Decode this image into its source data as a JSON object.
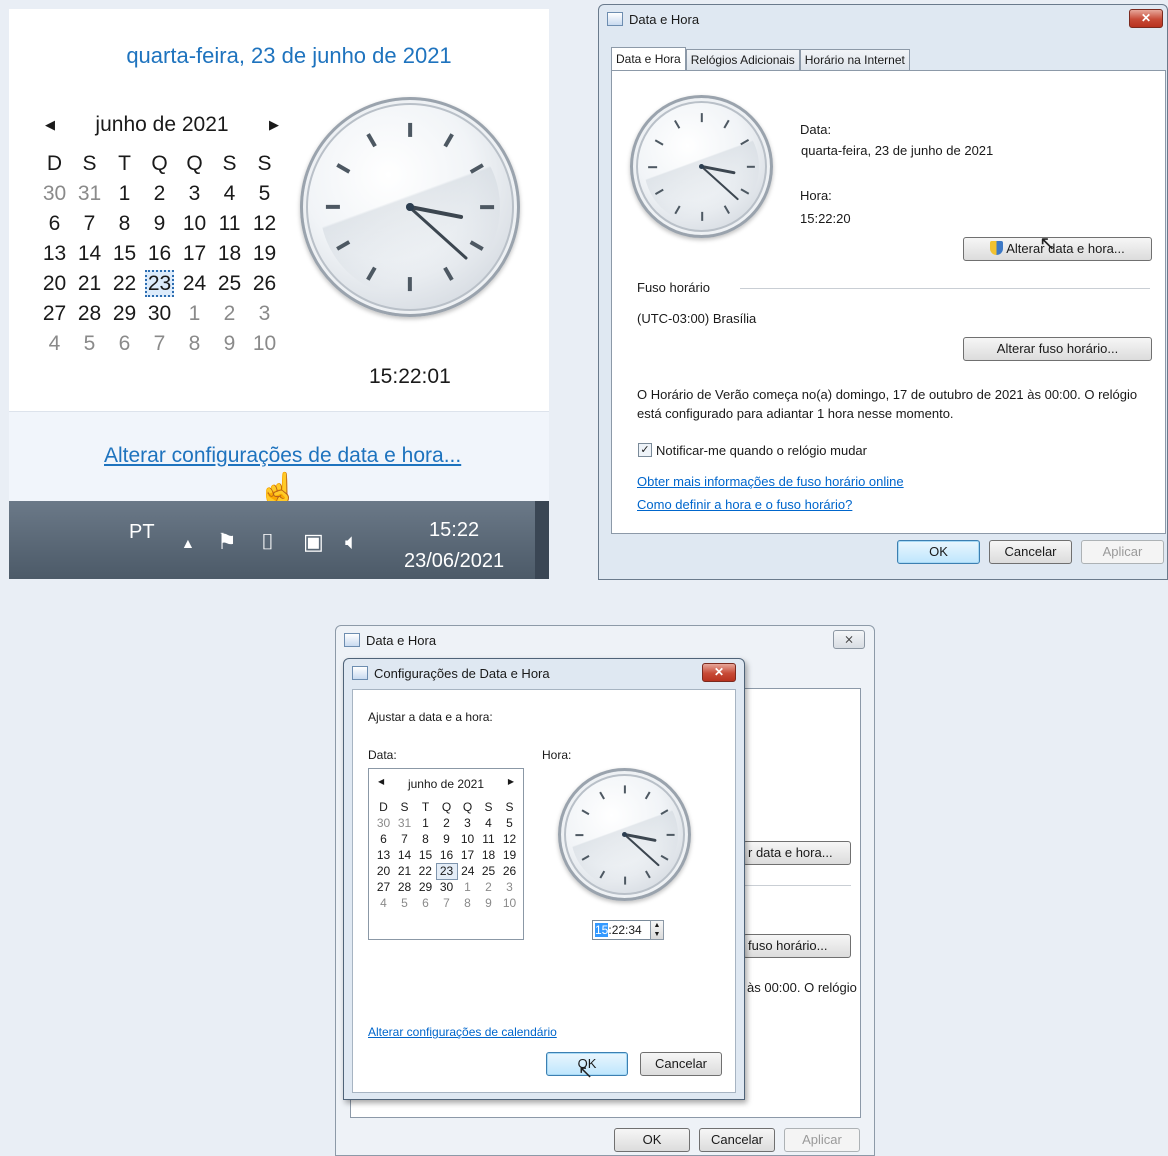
{
  "panel_a": {
    "date_title": "quarta-feira, 23 de junho de 2021",
    "month_label": "junho de 2021",
    "weekdays": [
      "D",
      "S",
      "T",
      "Q",
      "Q",
      "S",
      "S"
    ],
    "weeks": [
      [
        "30",
        "31",
        "1",
        "2",
        "3",
        "4",
        "5"
      ],
      [
        "6",
        "7",
        "8",
        "9",
        "10",
        "11",
        "12"
      ],
      [
        "13",
        "14",
        "15",
        "16",
        "17",
        "18",
        "19"
      ],
      [
        "20",
        "21",
        "22",
        "23",
        "24",
        "25",
        "26"
      ],
      [
        "27",
        "28",
        "29",
        "30",
        "1",
        "2",
        "3"
      ],
      [
        "4",
        "5",
        "6",
        "7",
        "8",
        "9",
        "10"
      ]
    ],
    "time": "15:22:01",
    "link": "Alterar configurações de data e hora...",
    "taskbar": {
      "lang": "PT",
      "clock_time": "15:22",
      "clock_date": "23/06/2021"
    }
  },
  "panel_b": {
    "title": "Data e Hora",
    "tabs": [
      "Data e Hora",
      "Relógios Adicionais",
      "Horário na Internet"
    ],
    "date_label": "Data:",
    "date_value": "quarta-feira, 23 de junho de 2021",
    "time_label": "Hora:",
    "time_value": "15:22:20",
    "change_datetime_btn": "Alterar data e hora...",
    "tz_heading": "Fuso horário",
    "tz_value": "(UTC-03:00) Brasília",
    "change_tz_btn": "Alterar fuso horário...",
    "dst_line1": "O Horário de Verão começa no(a) domingo, 17 de outubro de 2021 às 00:00. O relógio",
    "dst_line2": "está configurado para adiantar 1 hora nesse momento.",
    "notify_label": "Notificar-me quando o relógio mudar",
    "link1": "Obter mais informações de fuso horário online",
    "link2": "Como definir a hora e o fuso horário?",
    "ok": "OK",
    "cancel": "Cancelar",
    "apply": "Aplicar"
  },
  "panel_c": {
    "title": "Data e Hora",
    "close": "⨯",
    "partial_btn1": "r data e hora...",
    "partial_btn2": "fuso horário...",
    "partial_text": "às 00:00. O relógio",
    "ok": "OK",
    "cancel": "Cancelar",
    "apply": "Aplicar"
  },
  "panel_d": {
    "title": "Configurações de Data e Hora",
    "heading": "Ajustar a data e a hora:",
    "date_label": "Data:",
    "time_label": "Hora:",
    "month_label": "junho de 2021",
    "weekdays": [
      "D",
      "S",
      "T",
      "Q",
      "Q",
      "S",
      "S"
    ],
    "weeks": [
      [
        "30",
        "31",
        "1",
        "2",
        "3",
        "4",
        "5"
      ],
      [
        "6",
        "7",
        "8",
        "9",
        "10",
        "11",
        "12"
      ],
      [
        "13",
        "14",
        "15",
        "16",
        "17",
        "18",
        "19"
      ],
      [
        "20",
        "21",
        "22",
        "23",
        "24",
        "25",
        "26"
      ],
      [
        "27",
        "28",
        "29",
        "30",
        "1",
        "2",
        "3"
      ],
      [
        "4",
        "5",
        "6",
        "7",
        "8",
        "9",
        "10"
      ]
    ],
    "time_hour": "15",
    "time_rest": ":22:34",
    "calendar_link": "Alterar configurações de calendário",
    "ok": "OK",
    "cancel": "Cancelar"
  },
  "colors": {
    "link": "#1e73be",
    "close_red": "#c74a36",
    "accent_blue": "#3399ff"
  }
}
